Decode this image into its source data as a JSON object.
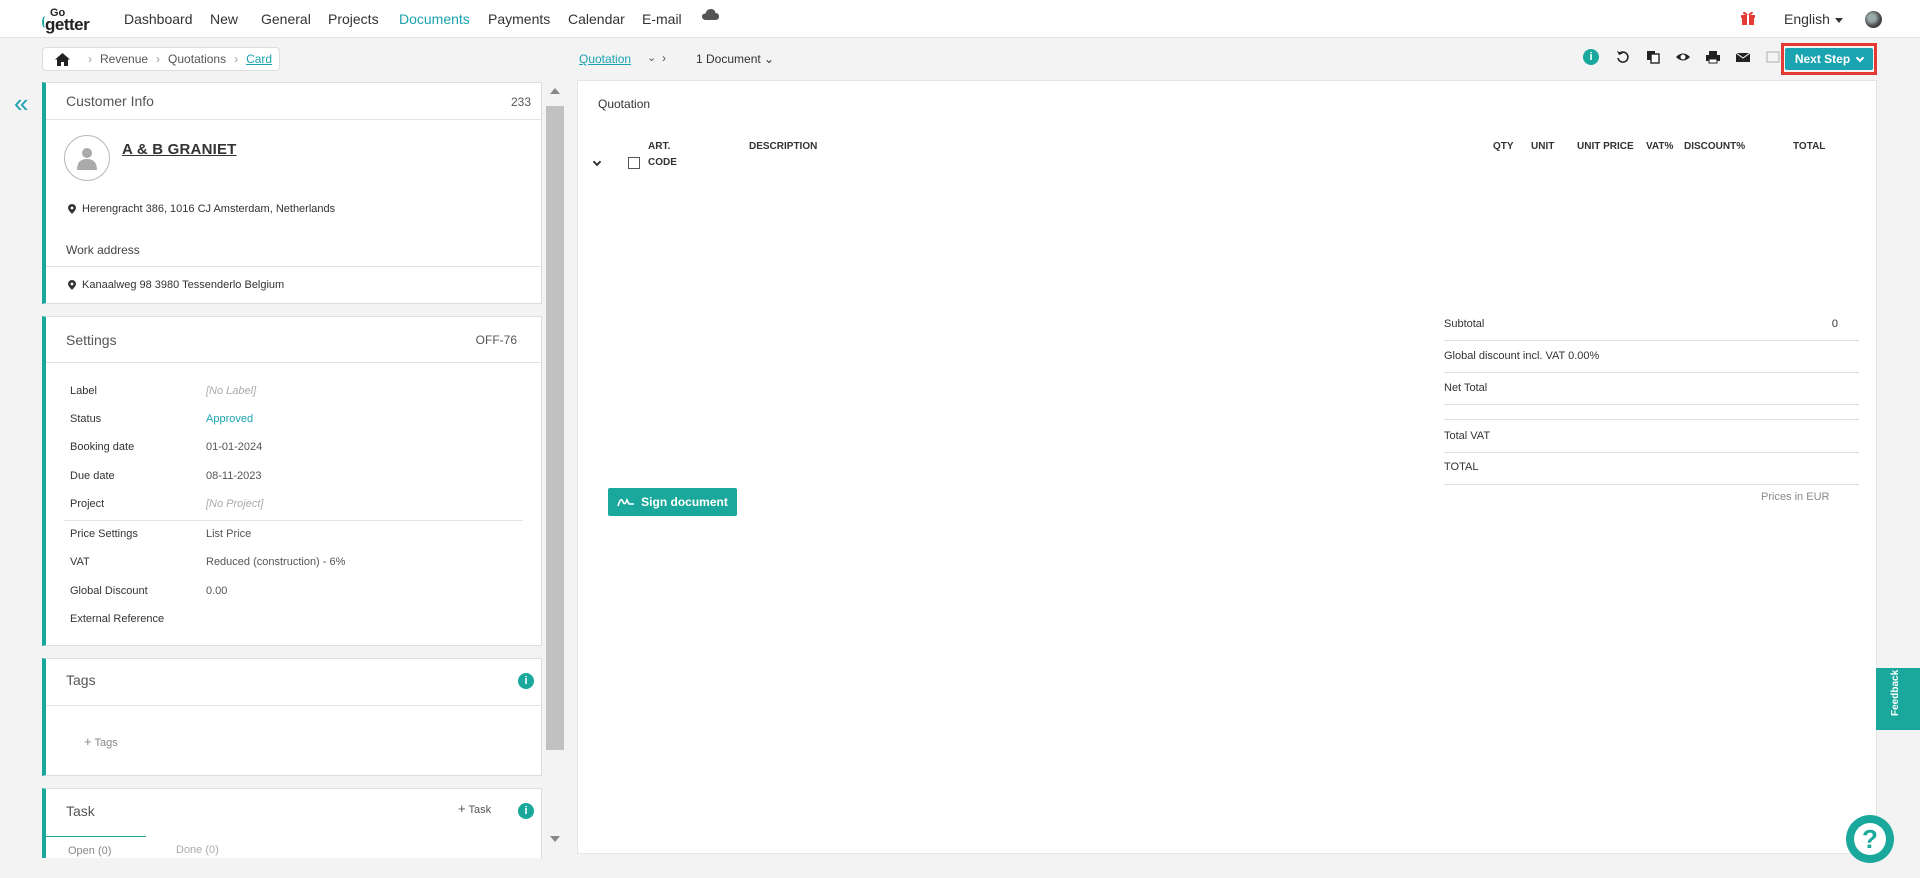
{
  "nav": {
    "logo_go": "Go",
    "logo_getter": "getter",
    "items": [
      "Dashboard",
      "New",
      "General",
      "Projects",
      "Documents",
      "Payments",
      "Calendar",
      "E-mail"
    ],
    "active": "Documents",
    "language": "English"
  },
  "breadcrumb": {
    "items": [
      "Revenue",
      "Quotations"
    ],
    "current": "Card"
  },
  "doc_selector": {
    "type": "Quotation",
    "count_label": "1 Document"
  },
  "next_step_label": "Next Step",
  "customer": {
    "title": "Customer Info",
    "number": "233",
    "name": "A & B GRANIET",
    "address": "Herengracht 386, 1016 CJ Amsterdam, Netherlands",
    "work_address_label": "Work address",
    "work_address": "Kanaalweg 98 3980 Tessenderlo Belgium"
  },
  "settings": {
    "title": "Settings",
    "code": "OFF-76",
    "rows": [
      {
        "label": "Label",
        "value": "[No Label]"
      },
      {
        "label": "Status",
        "value": "Approved"
      },
      {
        "label": "Booking date",
        "value": "01-01-2024"
      },
      {
        "label": "Due date",
        "value": "08-11-2023"
      },
      {
        "label": "Project",
        "value": "[No Project]"
      },
      {
        "label": "Price Settings",
        "value": "List Price"
      },
      {
        "label": "VAT",
        "value": "Reduced (construction) - 6%"
      },
      {
        "label": "Global Discount",
        "value": "0.00"
      },
      {
        "label": "External Reference",
        "value": ""
      }
    ]
  },
  "tags": {
    "title": "Tags",
    "add_label": "Tags"
  },
  "task": {
    "title": "Task",
    "add_label": "Task",
    "tabs": [
      "Open (0)",
      "Done (0)"
    ]
  },
  "document": {
    "title": "Quotation",
    "columns": {
      "art_code_1": "ART.",
      "art_code_2": "CODE",
      "description": "DESCRIPTION",
      "qty": "QTY",
      "unit": "UNIT",
      "unit_price": "UNIT PRICE",
      "vat": "VAT%",
      "discount": "DISCOUNT%",
      "total": "TOTAL"
    },
    "totals": {
      "subtotal_label": "Subtotal",
      "subtotal_value": "0",
      "global_discount_label": "Global discount incl. VAT 0.00%",
      "net_total_label": "Net Total",
      "total_vat_label": "Total VAT",
      "total_label": "TOTAL",
      "prices_note": "Prices in EUR"
    },
    "sign_label": "Sign document"
  },
  "feedback_label": "Feedback",
  "help_label": "?",
  "colors": {
    "accent": "#1aa3b0",
    "teal": "#1aa89c",
    "highlight": "#e53935"
  }
}
